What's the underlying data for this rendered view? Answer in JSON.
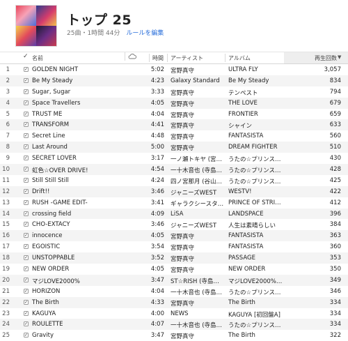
{
  "header": {
    "title": "トップ 25",
    "meta": "25曲・1時間 44分",
    "edit_rules_link": "ルールを編集"
  },
  "columns": {
    "check": "✓",
    "name": "名前",
    "time": "時間",
    "artist": "アーティスト",
    "album": "アルバム",
    "plays": "再生回数"
  },
  "tracks": [
    {
      "num": "1",
      "name": "GOLDEN NIGHT",
      "time": "5:02",
      "artist": "宮野真守",
      "album": "ULTRA FLY",
      "plays": "3,057"
    },
    {
      "num": "2",
      "name": "Be My Steady",
      "time": "4:23",
      "artist": "Galaxy Standard",
      "album": "Be My Steady",
      "plays": "834"
    },
    {
      "num": "3",
      "name": "Sugar, Sugar",
      "time": "3:33",
      "artist": "宮野真守",
      "album": "テンペスト",
      "plays": "794"
    },
    {
      "num": "4",
      "name": "Space Travellers",
      "time": "4:05",
      "artist": "宮野真守",
      "album": "THE LOVE",
      "plays": "679"
    },
    {
      "num": "5",
      "name": "TRUST ME",
      "time": "4:04",
      "artist": "宮野真守",
      "album": "FRONTIER",
      "plays": "659"
    },
    {
      "num": "6",
      "name": "TRANSFORM",
      "time": "4:41",
      "artist": "宮野真守",
      "album": "シャイン",
      "plays": "633"
    },
    {
      "num": "7",
      "name": "Secret Line",
      "time": "4:48",
      "artist": "宮野真守",
      "album": "FANTASISTA",
      "plays": "560"
    },
    {
      "num": "8",
      "name": "Last Around",
      "time": "5:00",
      "artist": "宮野真守",
      "album": "DREAM FIGHTER",
      "plays": "510"
    },
    {
      "num": "9",
      "name": "SECRET LOVER",
      "time": "3:17",
      "artist": "一ノ瀬トキヤ (宮…",
      "album": "うたの☆プリンス…",
      "plays": "430"
    },
    {
      "num": "10",
      "name": "虹色☆OVER DRIVE!",
      "time": "4:54",
      "artist": "一十木音也 (寺島…",
      "album": "うたの☆プリンス…",
      "plays": "428"
    },
    {
      "num": "11",
      "name": "Still Still Still",
      "time": "4:24",
      "artist": "四ノ宮那月 (谷山…",
      "album": "うたの☆プリンス…",
      "plays": "425"
    },
    {
      "num": "12",
      "name": "Drift!!",
      "time": "3:46",
      "artist": "ジャニーズWEST",
      "album": "WESTV!",
      "plays": "422"
    },
    {
      "num": "13",
      "name": "RUSH -GAME EDIT-",
      "time": "3:41",
      "artist": "ギャラクシースタ…",
      "album": "PRINCE OF STRI…",
      "plays": "412"
    },
    {
      "num": "14",
      "name": "crossing field",
      "time": "4:09",
      "artist": "LiSA",
      "album": "LANDSPACE",
      "plays": "396"
    },
    {
      "num": "15",
      "name": "CHO-EXTACY",
      "time": "3:46",
      "artist": "ジャニーズWEST",
      "album": "人生は素晴らしい",
      "plays": "384"
    },
    {
      "num": "16",
      "name": "innocence",
      "time": "4:05",
      "artist": "宮野真守",
      "album": "FANTASISTA",
      "plays": "363"
    },
    {
      "num": "17",
      "name": "EGOISTIC",
      "time": "3:54",
      "artist": "宮野真守",
      "album": "FANTASISTA",
      "plays": "360"
    },
    {
      "num": "18",
      "name": "UNSTOPPABLE",
      "time": "3:52",
      "artist": "宮野真守",
      "album": "PASSAGE",
      "plays": "353"
    },
    {
      "num": "19",
      "name": "NEW ORDER",
      "time": "4:05",
      "artist": "宮野真守",
      "album": "NEW ORDER",
      "plays": "350"
    },
    {
      "num": "20",
      "name": "マジLOVE2000%",
      "time": "3:47",
      "artist": "ST☆RISH (寺島…",
      "album": "マジLOVE2000%…",
      "plays": "349"
    },
    {
      "num": "21",
      "name": "HORIZON",
      "time": "4:04",
      "artist": "一十木音也 (寺島…",
      "album": "うたの☆プリンス…",
      "plays": "346"
    },
    {
      "num": "22",
      "name": "The Birth",
      "time": "4:33",
      "artist": "宮野真守",
      "album": "The Birth",
      "plays": "334"
    },
    {
      "num": "23",
      "name": "KAGUYA",
      "time": "4:00",
      "artist": "NEWS",
      "album": "KAGUYA [初回盤A]",
      "plays": "334"
    },
    {
      "num": "24",
      "name": "ROULETTE",
      "time": "4:07",
      "artist": "一十木音也 (寺島…",
      "album": "うたの☆プリンス…",
      "plays": "334"
    },
    {
      "num": "25",
      "name": "Gravity",
      "time": "3:47",
      "artist": "宮野真守",
      "album": "The Birth",
      "plays": "322"
    }
  ]
}
